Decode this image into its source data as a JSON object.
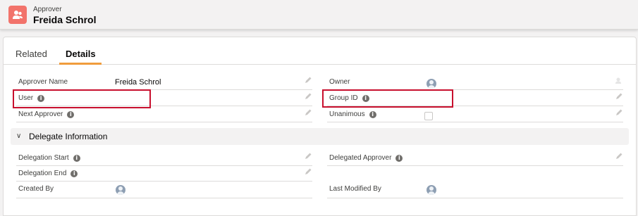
{
  "header": {
    "object_type": "Approver",
    "record_name": "Freida Schrol",
    "icon": "approver-user-icon"
  },
  "tabs": [
    {
      "label": "Related",
      "active": false
    },
    {
      "label": "Details",
      "active": true
    }
  ],
  "fields": {
    "approver_name": {
      "label": "Approver Name",
      "value": "Freida Schrol"
    },
    "owner": {
      "label": "Owner"
    },
    "user": {
      "label": "User"
    },
    "group_id": {
      "label": "Group ID"
    },
    "next_approver": {
      "label": "Next Approver"
    },
    "unanimous": {
      "label": "Unanimous",
      "checked": false
    }
  },
  "section": {
    "title": "Delegate Information",
    "expanded": true
  },
  "delegate_fields": {
    "delegation_start": {
      "label": "Delegation Start"
    },
    "delegated_approver": {
      "label": "Delegated Approver"
    },
    "delegation_end": {
      "label": "Delegation End"
    },
    "created_by": {
      "label": "Created By"
    },
    "last_modified_by": {
      "label": "Last Modified By"
    }
  },
  "colors": {
    "icon_bg": "#f2736b",
    "tab_accent": "#f09c3d",
    "highlight": "#c8102e"
  }
}
